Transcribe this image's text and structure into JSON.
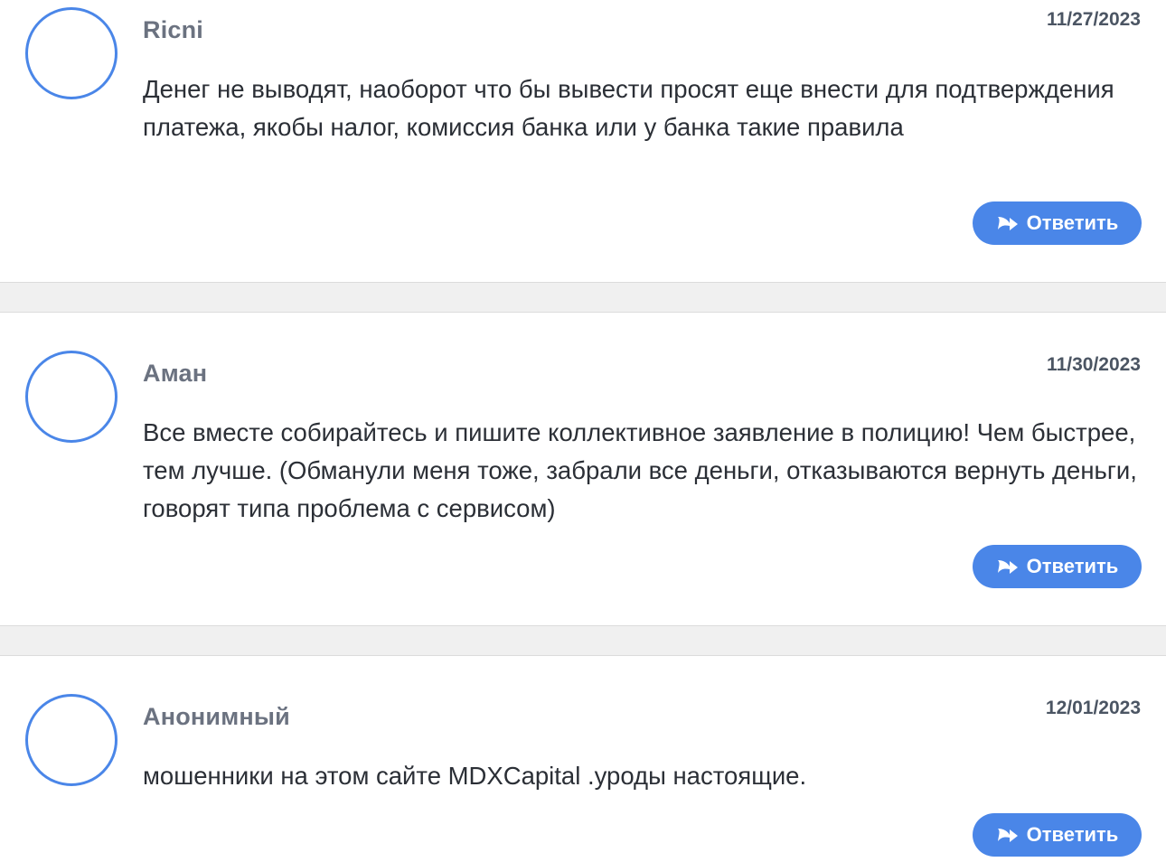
{
  "comments": [
    {
      "author": "Ricni",
      "date": "11/27/2023",
      "text": "Денег не выводят, наоборот что бы вывести просят еще внести для подтверждения платежа, якобы налог, комиссия банка или у банка такие правила",
      "reply_label": "Ответить"
    },
    {
      "author": "Аман",
      "date": "11/30/2023",
      "text": "Все вместе собирайтесь и пишите коллективное заявление в полицию! Чем быстрее, тем лучше. (Обманули меня тоже, забрали все деньги, отказываются вернуть деньги, говорят типа проблема с сервисом)",
      "reply_label": "Ответить"
    },
    {
      "author": "Анонимный",
      "date": "12/01/2023",
      "text": "мошенники на этом сайте MDXCapital .уроды настоящие.",
      "reply_label": "Ответить"
    }
  ],
  "colors": {
    "accent": "#4a86e8",
    "author_text": "#6b7280",
    "divider": "#f0f0f0"
  },
  "icons": {
    "reply": "reply-arrow-icon",
    "avatar": "avatar-placeholder"
  }
}
